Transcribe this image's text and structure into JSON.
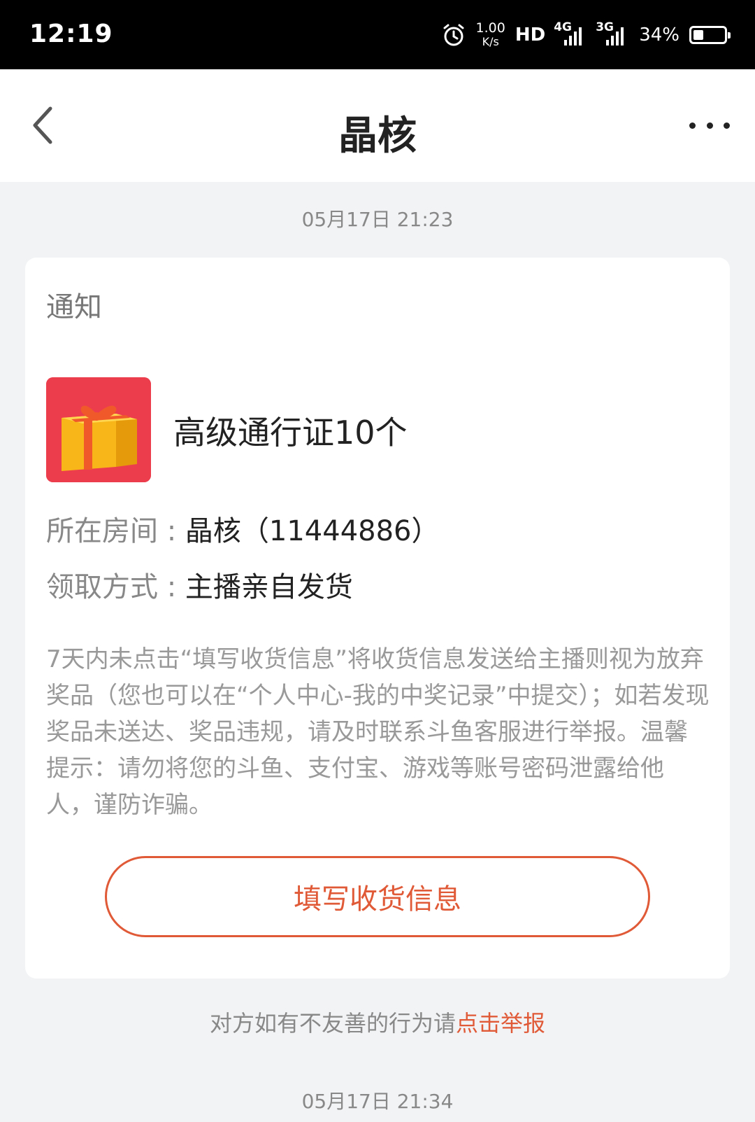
{
  "status_bar": {
    "time": "12:19",
    "net_speed_value": "1.00",
    "net_speed_unit": "K/s",
    "hd_label": "HD",
    "sim1_label": "4G",
    "sim2_label": "3G",
    "battery_percent": "34%",
    "battery_level": 0.34
  },
  "nav": {
    "title": "晶核",
    "back_icon": "chevron-left-icon",
    "more_icon": "more-dots-icon"
  },
  "messages": [
    {
      "timestamp": "05月17日 21:23",
      "card": {
        "title": "通知",
        "prize_icon": "gift-box-icon",
        "prize_name": "高级通行证10个",
        "room_label": "所在房间 : ",
        "room_value": "晶核（11444886）",
        "method_label": "领取方式 : ",
        "method_value": "主播亲自发货",
        "notice": "7天内未点击“填写收货信息”将收货信息发送给主播则视为放弃奖品（您也可以在“个人中心-我的中奖记录”中提交）；如若发现奖品未送达、奖品违规，请及时联系斗鱼客服进行举报。温馨提示：请勿将您的斗鱼、支付宝、游戏等账号密码泄露给他人，谨防诈骗。",
        "button_label": "填写收货信息"
      },
      "report_prefix": "对方如有不友善的行为请",
      "report_link": "点击举报"
    },
    {
      "timestamp": "05月17日 21:34"
    }
  ],
  "colors": {
    "accent": "#e05a38",
    "background": "#f2f3f5",
    "gift_bg": "#ec3d4d"
  }
}
